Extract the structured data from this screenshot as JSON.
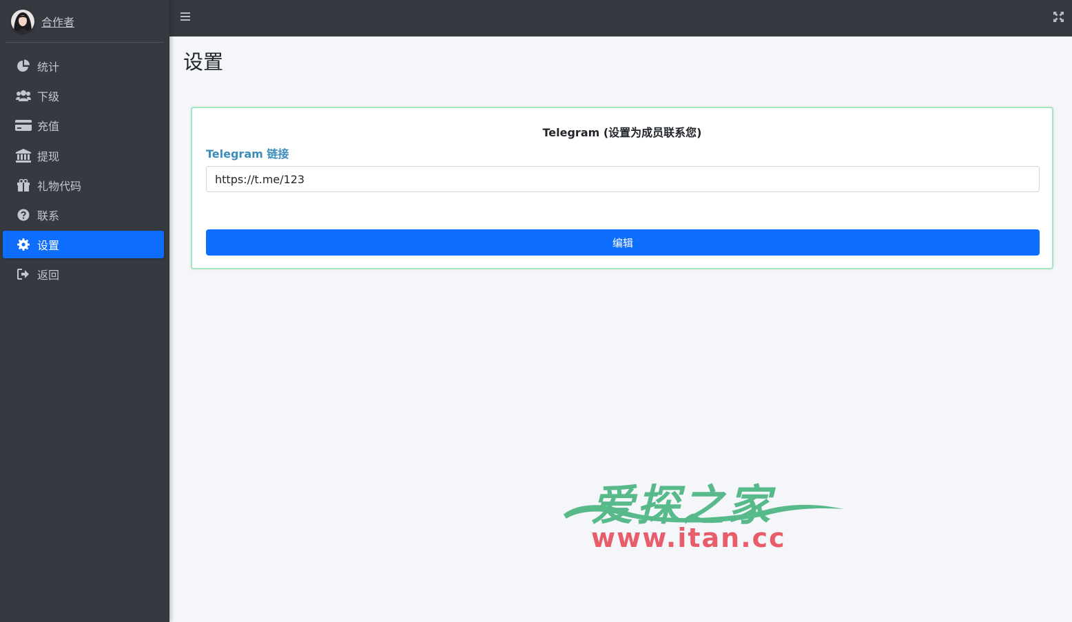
{
  "sidebar": {
    "user_name": "合作者",
    "items": [
      {
        "label": "统计",
        "icon": "pie-chart-icon",
        "active": false
      },
      {
        "label": "下级",
        "icon": "users-icon",
        "active": false
      },
      {
        "label": "充值",
        "icon": "credit-card-icon",
        "active": false
      },
      {
        "label": "提现",
        "icon": "bank-icon",
        "active": false
      },
      {
        "label": "礼物代码",
        "icon": "gift-icon",
        "active": false
      },
      {
        "label": "联系",
        "icon": "question-circle-icon",
        "active": false
      },
      {
        "label": "设置",
        "icon": "gear-icon",
        "active": true
      },
      {
        "label": "返回",
        "icon": "sign-out-icon",
        "active": false
      }
    ]
  },
  "topbar": {
    "menu_icon": "hamburger-icon",
    "fullscreen_icon": "expand-icon"
  },
  "main": {
    "page_title": "设置",
    "card": {
      "title": "Telegram (设置为成员联系您)",
      "field_label": "Telegram 链接",
      "field_value": "https://t.me/123",
      "button_label": "编辑"
    }
  },
  "watermark": {
    "text_cn": "爱探之家",
    "text_url": "www.itan.cc"
  },
  "colors": {
    "sidebar_bg": "#343a40",
    "active_item": "#0d6efd",
    "card_border": "#a3e6be",
    "label_blue": "#3c8dbc",
    "watermark_green": "#58b98a",
    "watermark_red": "#e85d6a"
  }
}
